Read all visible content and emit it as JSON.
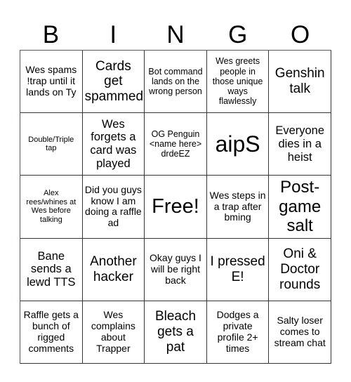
{
  "header": {
    "letters": [
      "B",
      "I",
      "N",
      "G",
      "O"
    ]
  },
  "grid": {
    "rows": 5,
    "columns": 5,
    "cells": [
      {
        "text": "Wes spams !trap until it lands on Ty",
        "size": "fs-md"
      },
      {
        "text": "Cards get spammed",
        "size": "fs-xl"
      },
      {
        "text": "Bot command lands on the wrong person",
        "size": "fs-sm"
      },
      {
        "text": "Wes greets people in those unique ways flawlessly",
        "size": "fs-sm"
      },
      {
        "text": "Genshin talk",
        "size": "fs-xl"
      },
      {
        "text": "Double/Triple tap",
        "size": "fs-xs"
      },
      {
        "text": "Wes forgets a card was played",
        "size": "fs-lg"
      },
      {
        "text": "OG Penguin <name here> drdeEZ",
        "size": "fs-sm"
      },
      {
        "text": "aipS",
        "size": "fs-huge"
      },
      {
        "text": "Everyone dies in a heist",
        "size": "fs-lg"
      },
      {
        "text": "Alex rees/whines at Wes before talking",
        "size": "fs-xs"
      },
      {
        "text": "Did you guys know I am doing a raffle ad",
        "size": "fs-md"
      },
      {
        "text": "Free!",
        "size": "fs-free"
      },
      {
        "text": "Wes steps in a trap after bming",
        "size": "fs-md"
      },
      {
        "text": "Post-game salt",
        "size": "fs-xxl"
      },
      {
        "text": "Bane sends a lewd TTS",
        "size": "fs-lg"
      },
      {
        "text": "Another hacker",
        "size": "fs-xl"
      },
      {
        "text": "Okay guys I will be right back",
        "size": "fs-md"
      },
      {
        "text": "I pressed E!",
        "size": "fs-xl"
      },
      {
        "text": "Oni & Doctor rounds",
        "size": "fs-xl"
      },
      {
        "text": "Raffle gets a bunch of rigged comments",
        "size": "fs-md"
      },
      {
        "text": "Wes complains about Trapper",
        "size": "fs-md"
      },
      {
        "text": "Bleach gets a pat",
        "size": "fs-xl"
      },
      {
        "text": "Dodges a private profile 2+ times",
        "size": "fs-md"
      },
      {
        "text": "Salty loser comes to stream chat",
        "size": "fs-md"
      }
    ]
  },
  "colors": {
    "background": "#ffffff",
    "cell_background": "#ffffff",
    "grid_border": "#333638",
    "text": "#000000"
  }
}
